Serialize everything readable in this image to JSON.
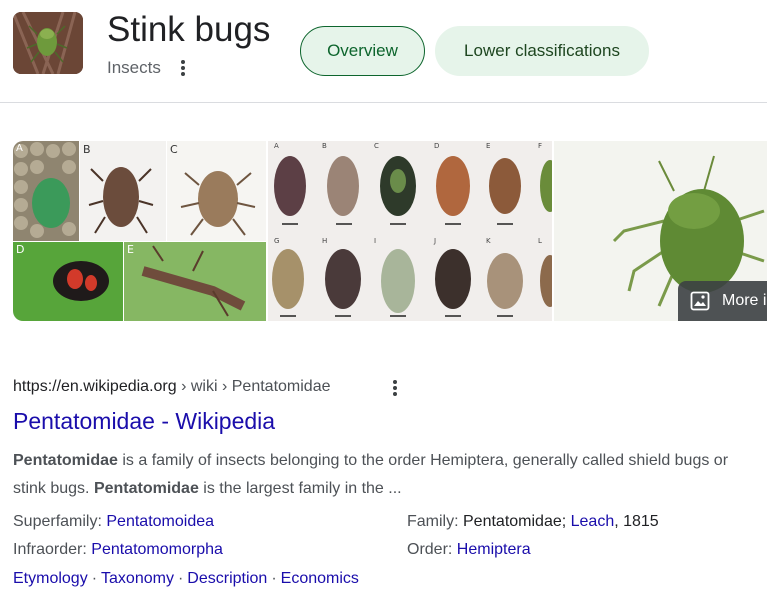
{
  "header": {
    "title": "Stink bugs",
    "subtitle": "Insects",
    "chips": {
      "overview": "Overview",
      "lower": "Lower classifications"
    }
  },
  "images": {
    "panel1_letters": [
      "A",
      "B",
      "C",
      "D",
      "E"
    ],
    "panel2_letters": [
      "A",
      "B",
      "C",
      "D",
      "E",
      "F",
      "G",
      "H",
      "I",
      "J",
      "K",
      "L"
    ],
    "more_label": "More i"
  },
  "result": {
    "url_domain": "https://en.wikipedia.org",
    "url_path": " › wiki › Pentatomidae",
    "title": "Pentatomidae - Wikipedia",
    "snippet_bold1": "Pentatomidae",
    "snippet_text1": " is a family of insects belonging to the order Hemiptera, generally called shield bugs or stink bugs. ",
    "snippet_bold2": "Pentatomidae",
    "snippet_text2": " is the largest family in the ...",
    "facts": {
      "superfamily_label": "Superfamily: ",
      "superfamily_value": "Pentatomoidea",
      "infraorder_label": "Infraorder: ",
      "infraorder_value": "Pentatomomorpha",
      "family_label": "Family: ",
      "family_value": "Pentatomidae; ",
      "family_link": "Leach",
      "family_year": ", 1815",
      "order_label": "Order: ",
      "order_value": "Hemiptera"
    },
    "sitelinks": [
      "Etymology",
      "Taxonomy",
      "Description",
      "Economics"
    ],
    "separator": "·"
  },
  "colors": {
    "link": "#1a0dab",
    "chip_bg": "#e6f4ea",
    "chip_text": "#0d652d"
  }
}
